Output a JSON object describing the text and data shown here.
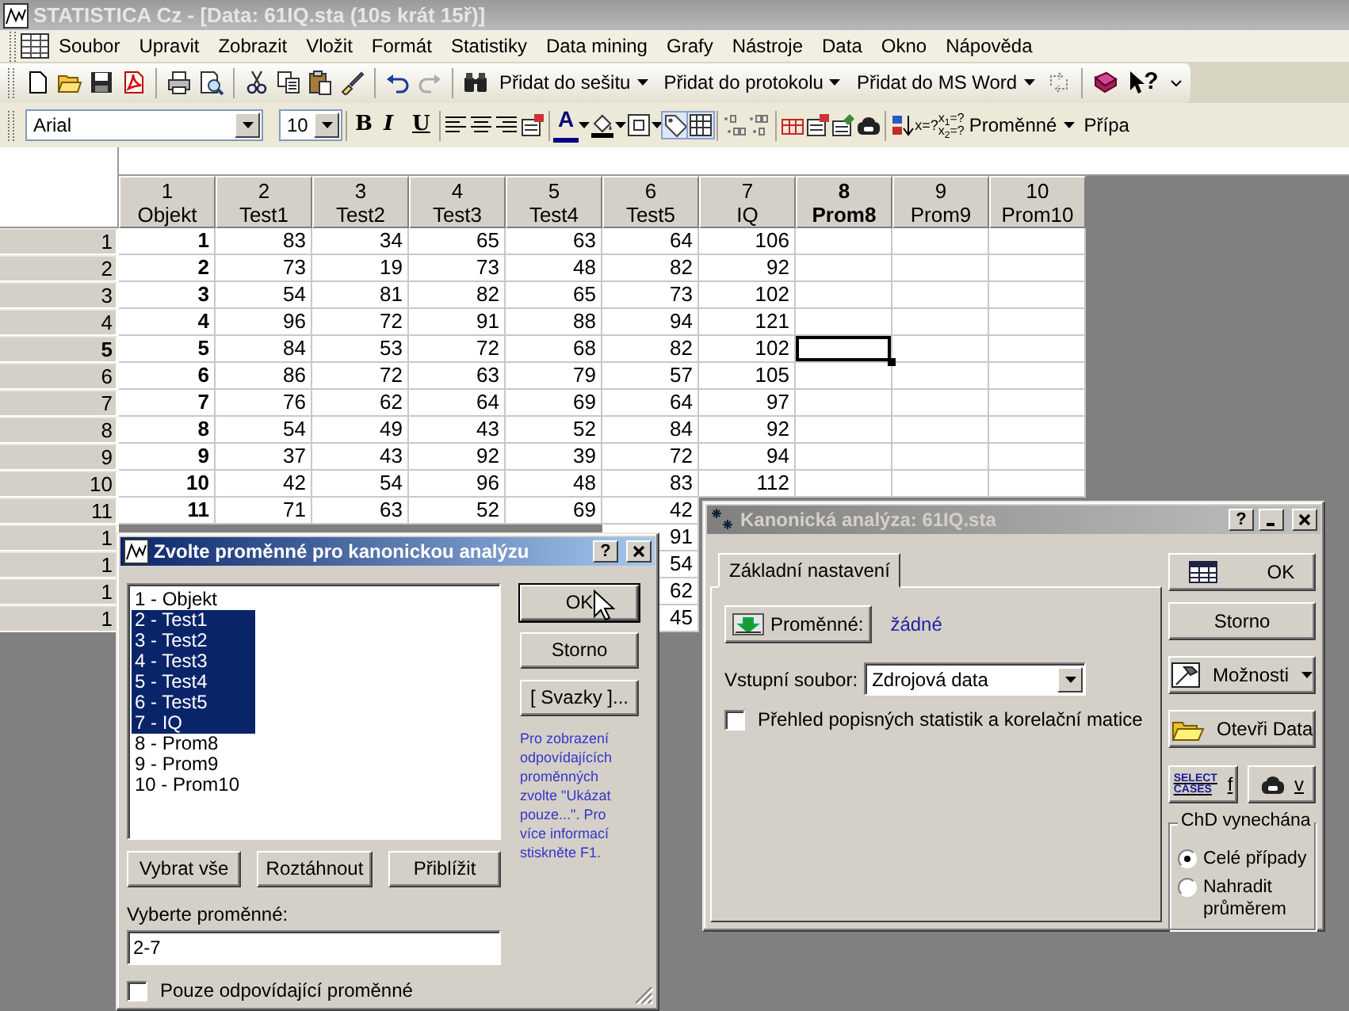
{
  "window": {
    "title": "STATISTICA Cz - [Data: 61IQ.sta (10s krát 15ř)]"
  },
  "menu": [
    "Soubor",
    "Upravit",
    "Zobrazit",
    "Vložit",
    "Formát",
    "Statistiky",
    "Data mining",
    "Grafy",
    "Nástroje",
    "Data",
    "Okno",
    "Nápověda"
  ],
  "toolbar": {
    "add_buttons": [
      "Přidat do sešitu",
      "Přidat do protokolu",
      "Přidat do MS Word"
    ],
    "help_mark": "?"
  },
  "format_bar": {
    "font": "Arial",
    "size": "10",
    "bold": "B",
    "italic": "I",
    "underline": "U",
    "font_color": "A",
    "formula": "x=?",
    "formula_pair": [
      "x$_{1}$=?",
      "x$_{2}$=?"
    ],
    "variables": "Proměnné",
    "cases": "Přípa"
  },
  "sheet": {
    "columns": [
      {
        "number": "1",
        "name": "Objekt",
        "bold": true,
        "selected": false
      },
      {
        "number": "2",
        "name": "Test1",
        "bold": false,
        "selected": false
      },
      {
        "number": "3",
        "name": "Test2",
        "bold": false,
        "selected": false
      },
      {
        "number": "4",
        "name": "Test3",
        "bold": false,
        "selected": false
      },
      {
        "number": "5",
        "name": "Test4",
        "bold": false,
        "selected": false
      },
      {
        "number": "6",
        "name": "Test5",
        "bold": false,
        "selected": false
      },
      {
        "number": "7",
        "name": "IQ",
        "bold": false,
        "selected": false
      },
      {
        "number": "8",
        "name": "Prom8",
        "bold": false,
        "selected": true
      },
      {
        "number": "9",
        "name": "Prom9",
        "bold": false,
        "selected": false
      },
      {
        "number": "10",
        "name": "Prom10",
        "bold": false,
        "selected": false
      }
    ],
    "rows": [
      {
        "label": "1",
        "selected": false,
        "cells": [
          "1",
          "83",
          "34",
          "65",
          "63",
          "64",
          "106",
          null,
          null,
          null
        ]
      },
      {
        "label": "2",
        "selected": false,
        "cells": [
          "2",
          "73",
          "19",
          "73",
          "48",
          "82",
          "92",
          null,
          null,
          null
        ]
      },
      {
        "label": "3",
        "selected": false,
        "cells": [
          "3",
          "54",
          "81",
          "82",
          "65",
          "73",
          "102",
          null,
          null,
          null
        ]
      },
      {
        "label": "4",
        "selected": false,
        "cells": [
          "4",
          "96",
          "72",
          "91",
          "88",
          "94",
          "121",
          null,
          null,
          null
        ]
      },
      {
        "label": "5",
        "selected": true,
        "cells": [
          "5",
          "84",
          "53",
          "72",
          "68",
          "82",
          "102",
          null,
          null,
          null
        ]
      },
      {
        "label": "6",
        "selected": false,
        "cells": [
          "6",
          "86",
          "72",
          "63",
          "79",
          "57",
          "105",
          null,
          null,
          null
        ]
      },
      {
        "label": "7",
        "selected": false,
        "cells": [
          "7",
          "76",
          "62",
          "64",
          "69",
          "64",
          "97",
          null,
          null,
          null
        ]
      },
      {
        "label": "8",
        "selected": false,
        "cells": [
          "8",
          "54",
          "49",
          "43",
          "52",
          "84",
          "92",
          null,
          null,
          null
        ]
      },
      {
        "label": "9",
        "selected": false,
        "cells": [
          "9",
          "37",
          "43",
          "92",
          "39",
          "72",
          "94",
          null,
          null,
          null
        ]
      },
      {
        "label": "10",
        "selected": false,
        "cells": [
          "10",
          "42",
          "54",
          "96",
          "48",
          "83",
          "112",
          null,
          null,
          null
        ]
      },
      {
        "label": "11",
        "selected": false,
        "cells": [
          "11",
          "71",
          "63",
          "52",
          "69",
          "42",
          null,
          null,
          null,
          null
        ]
      },
      {
        "label": "1",
        "selected": false,
        "cells": [
          null,
          null,
          null,
          null,
          null,
          "91",
          null,
          null,
          null,
          null
        ]
      },
      {
        "label": "1",
        "selected": false,
        "cells": [
          null,
          null,
          null,
          null,
          null,
          "54",
          null,
          null,
          null,
          null
        ]
      },
      {
        "label": "1",
        "selected": false,
        "cells": [
          null,
          null,
          null,
          null,
          null,
          "62",
          null,
          null,
          null,
          null
        ]
      },
      {
        "label": "1",
        "selected": false,
        "cells": [
          null,
          null,
          null,
          null,
          null,
          "45",
          null,
          null,
          null,
          null
        ]
      }
    ]
  },
  "variables_dialog": {
    "title": "Zvolte proměnné pro kanonickou analýzu",
    "help": "?",
    "variables": [
      {
        "label": "1 - Objekt",
        "selected": false
      },
      {
        "label": "2 - Test1",
        "selected": true
      },
      {
        "label": "3 - Test2",
        "selected": true
      },
      {
        "label": "4 - Test3",
        "selected": true
      },
      {
        "label": "5 - Test4",
        "selected": true
      },
      {
        "label": "6 - Test5",
        "selected": true
      },
      {
        "label": "7 - IQ",
        "selected": true
      },
      {
        "label": "8 - Prom8",
        "selected": false
      },
      {
        "label": "9 - Prom9",
        "selected": false
      },
      {
        "label": "10 - Prom10",
        "selected": false
      }
    ],
    "buttons": [
      "OK",
      "Storno",
      "[ Svazky ]..."
    ],
    "hint": "Pro zobrazení odpovídajících proměnných zvolte \"Ukázat pouze...\". Pro více informací stiskněte F1.",
    "list_buttons": [
      "Vybrat vše",
      "Roztáhnout",
      "Přiblížit"
    ],
    "field_label": "Vyberte proměnné:",
    "field_value": "2-7",
    "checkbox": {
      "label": "Pouze odpovídající proměnné",
      "checked": false
    }
  },
  "analysis_dialog": {
    "title": "Kanonická analýza: 61IQ.sta",
    "help": "?",
    "tabs": [
      {
        "label": "Základní nastavení",
        "selected": true
      }
    ],
    "variables_button": "Proměnné:",
    "variables_value": "žádné",
    "input_label": "Vstupní soubor:",
    "input_value": "Zdrojová data",
    "checkbox": {
      "label": "Přehled popisných statistik a korelační matice",
      "checked": false
    },
    "buttons": [
      {
        "kind": "ok",
        "label": "OK"
      },
      {
        "kind": "plain",
        "label": "Storno"
      },
      {
        "kind": "options",
        "label": "Možnosti"
      },
      {
        "kind": "open",
        "label": "Otevři Data"
      }
    ],
    "select_cases": {
      "icon_text": "SELECT CASES",
      "label": "f"
    },
    "weight": {
      "label": "v"
    },
    "missing": {
      "title": "ChD vynechána",
      "options": [
        {
          "label": "Celé případy",
          "selected": true
        },
        {
          "label": "Nahradit průměrem",
          "selected": false
        }
      ]
    }
  }
}
